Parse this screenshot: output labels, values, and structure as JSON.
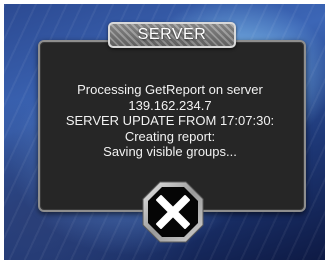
{
  "dialog": {
    "title": "SERVER",
    "lines": [
      "Processing GetReport on server",
      "139.162.234.7",
      "SERVER UPDATE FROM 17:07:30:",
      "Creating report:",
      "Saving visible groups..."
    ]
  },
  "icons": {
    "close": "close-x-icon"
  },
  "colors": {
    "panel": "#262626",
    "panel_border": "#8e8e8e",
    "text": "#f2f2f2",
    "background": "#3c66b6"
  }
}
